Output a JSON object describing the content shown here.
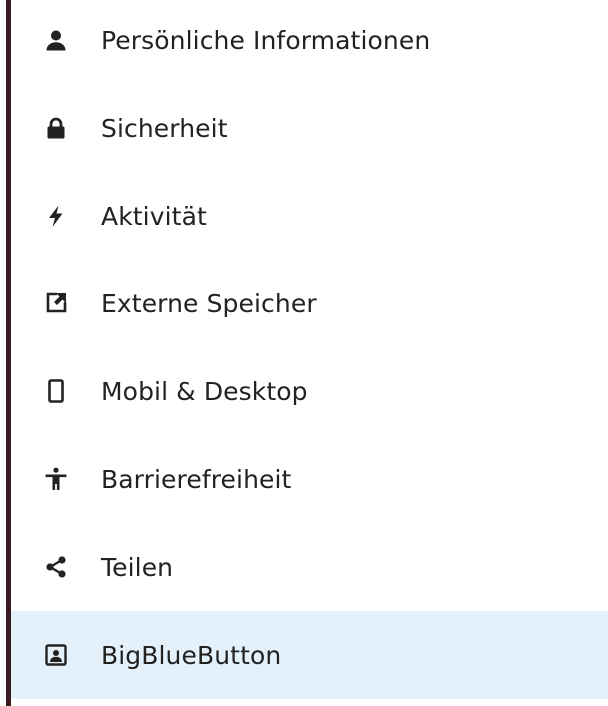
{
  "sidebar": {
    "items": [
      {
        "label": "Persönliche Informationen",
        "icon": "user-icon"
      },
      {
        "label": "Sicherheit",
        "icon": "lock-icon"
      },
      {
        "label": "Aktivität",
        "icon": "lightning-icon"
      },
      {
        "label": "Externe Speicher",
        "icon": "external-link-icon"
      },
      {
        "label": "Mobil & Desktop",
        "icon": "phone-icon"
      },
      {
        "label": "Barrierefreiheit",
        "icon": "accessibility-icon"
      },
      {
        "label": "Teilen",
        "icon": "share-icon"
      },
      {
        "label": "BigBlueButton",
        "icon": "presentation-user-icon",
        "active": true
      }
    ]
  },
  "colors": {
    "active_background": "#e5f1fa",
    "left_border": "#3a1b1f",
    "text": "#222222"
  }
}
